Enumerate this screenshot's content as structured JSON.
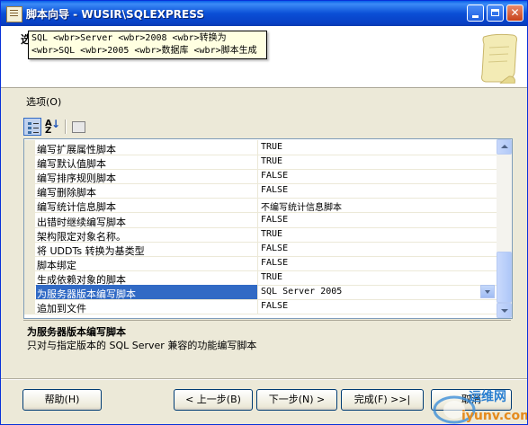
{
  "window": {
    "title": "脚本向导 - WUSIR\\SQLEXPRESS",
    "controls": [
      "minimize-icon",
      "maximize-icon",
      "close-icon"
    ]
  },
  "header": {
    "title": "选",
    "tooltip_line1": "SQL <wbr>Server <wbr>2008 <wbr>转换为",
    "tooltip_line2": "<wbr>SQL <wbr>2005 <wbr>数据库 <wbr>脚本生成"
  },
  "options": {
    "label": "选项(O)"
  },
  "grid": {
    "rows": [
      {
        "name": "编写扩展属性脚本",
        "value": "TRUE"
      },
      {
        "name": "编写默认值脚本",
        "value": "TRUE"
      },
      {
        "name": "编写排序规则脚本",
        "value": "FALSE"
      },
      {
        "name": "编写删除脚本",
        "value": "FALSE"
      },
      {
        "name": "编写统计信息脚本",
        "value": "不编写统计信息脚本"
      },
      {
        "name": "出错时继续编写脚本",
        "value": "FALSE"
      },
      {
        "name": "架构限定对象名称。",
        "value": "TRUE"
      },
      {
        "name": "将 UDDTs 转换为基类型",
        "value": "FALSE"
      },
      {
        "name": "脚本绑定",
        "value": "FALSE"
      },
      {
        "name": "生成依赖对象的脚本",
        "value": "TRUE"
      },
      {
        "name": "为服务器版本编写脚本",
        "value": "SQL Server 2005",
        "selected": true
      },
      {
        "name": "追加到文件",
        "value": "FALSE"
      }
    ]
  },
  "description": {
    "title": "为服务器版本编写脚本",
    "text": "只对与指定版本的 SQL Server 兼容的功能编写脚本"
  },
  "buttons": {
    "help": "帮助(H)",
    "back": "< 上一步(B)",
    "next": "下一步(N) >",
    "finish": "完成(F) >>|",
    "cancel": "取消"
  },
  "watermark": {
    "line1": "运维网",
    "line2": "iyunv.com"
  },
  "colors": {
    "titlebar": "#0a4fd6",
    "selection": "#316ac5",
    "tooltip_bg": "#ffffe1",
    "dialog_bg": "#ece9d8"
  }
}
